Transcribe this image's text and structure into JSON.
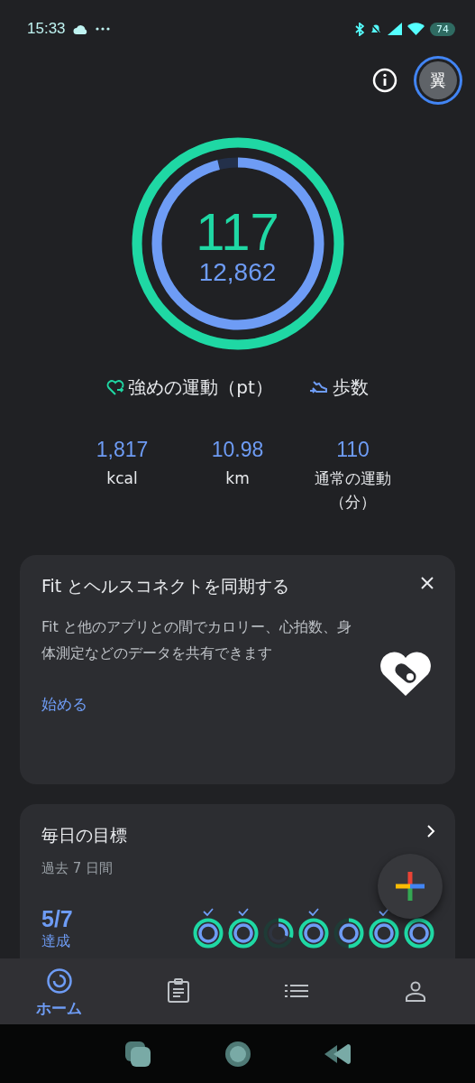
{
  "status_bar": {
    "time": "15:33",
    "battery": "74"
  },
  "header": {
    "avatar": "翼"
  },
  "summary": {
    "heart_points": "117",
    "steps": "12,862",
    "heart_ring": {
      "level": 1
    },
    "steps_ring": {
      "level": 0.96
    }
  },
  "legend": [
    {
      "kind": "heart",
      "label": "強めの運動（pt）"
    },
    {
      "kind": "steps",
      "label": "歩数"
    }
  ],
  "stats": [
    {
      "value": "1,817",
      "unit": "kcal"
    },
    {
      "value": "10.98",
      "unit": "km"
    },
    {
      "value": "110",
      "unit": "通常の運動（分）"
    }
  ],
  "sync_card": {
    "title": "Fit とヘルスコネクトを同期する",
    "body": "Fit と他のアプリとの間でカロリー、心拍数、身体測定などのデータを共有できます",
    "action": "始める"
  },
  "goals_card": {
    "title": "毎日の目標",
    "subtitle": "過去 7 日間",
    "achieved": "5/7",
    "achieved_label": "達成",
    "days": [
      {
        "checked": true,
        "heart_ring": {
          "level": 1
        },
        "steps_ring": {
          "level": 1
        }
      },
      {
        "checked": true,
        "heart_ring": {
          "level": 1
        },
        "steps_ring": {
          "level": 1
        }
      },
      {
        "checked": false,
        "heart_ring": {
          "level": 0.3
        },
        "steps_ring": {
          "level": 0.3
        }
      },
      {
        "checked": true,
        "heart_ring": {
          "level": 1
        },
        "steps_ring": {
          "level": 1
        }
      },
      {
        "checked": false,
        "heart_ring": {
          "level": 0.5
        },
        "steps_ring": {
          "level": 1
        }
      },
      {
        "checked": true,
        "heart_ring": {
          "level": 1
        },
        "steps_ring": {
          "level": 1
        }
      },
      {
        "checked": false,
        "heart_ring": {
          "level": 1
        },
        "steps_ring": {
          "level": 1
        }
      }
    ]
  },
  "bottom_nav": [
    {
      "kind": "home",
      "label": "ホーム",
      "selected": true
    },
    {
      "kind": "journal",
      "selected": false
    },
    {
      "kind": "browse",
      "selected": false
    },
    {
      "kind": "profile",
      "selected": false
    }
  ]
}
